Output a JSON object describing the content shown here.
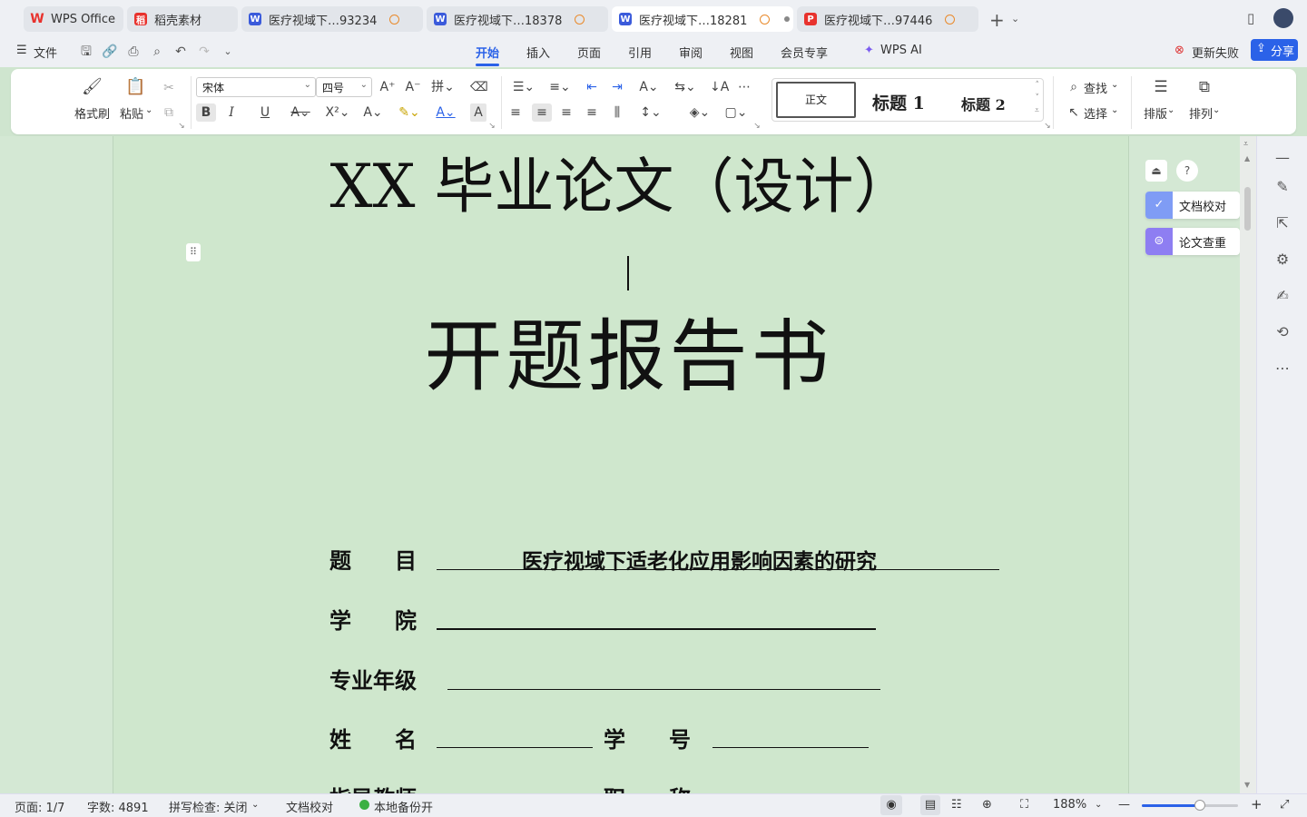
{
  "tabs": [
    {
      "label": "WPS Office",
      "icon": "wps-logo-icon",
      "color": "#e8322d"
    },
    {
      "label": "稻壳素材",
      "icon": "docer-icon",
      "color": "#e8322d"
    },
    {
      "label": "医疗视域下…93234",
      "icon": "word-doc-icon",
      "color": "#3b5bdb",
      "warning": true
    },
    {
      "label": "医疗视域下…18378",
      "icon": "word-doc-icon",
      "color": "#3b5bdb",
      "warning": true
    },
    {
      "label": "医疗视域下…18281",
      "icon": "word-doc-icon",
      "color": "#3b5bdb",
      "warning": true,
      "active": true
    },
    {
      "label": "医疗视域下…97446",
      "icon": "ppt-doc-icon",
      "color": "#e8322d",
      "warning": true
    }
  ],
  "menu": {
    "file": "文件",
    "tabs": [
      "开始",
      "插入",
      "页面",
      "引用",
      "审阅",
      "视图",
      "会员专享"
    ],
    "active": "开始",
    "wps_ai": "WPS AI",
    "update_failed": "更新失败",
    "share": "分享"
  },
  "ribbon": {
    "format_painter": "格式刷",
    "paste": "粘贴",
    "font_name": "宋体",
    "font_size": "四号",
    "style_normal": "正文",
    "style_h1": "标题 1",
    "style_h2": "标题 2",
    "find": "查找",
    "select": "选择",
    "layout": "排版",
    "arrange": "排列",
    "bold": "B",
    "italic": "I",
    "underline": "U"
  },
  "document": {
    "title": "XX 毕业论文（设计）",
    "subtitle": "开题报告书",
    "fields": {
      "topic_label": "题　　目",
      "topic_value": "医疗视域下适老化应用影响因素的研究",
      "college_label": "学　　院",
      "major_label": "专业年级",
      "name_label": "姓　　名",
      "student_id_label": "学　　号",
      "advisor_label": "指导教师",
      "title_label": "职　　称"
    }
  },
  "side_tools": {
    "proofread": "文档校对",
    "plagiarism": "论文查重"
  },
  "status": {
    "page": "页面: 1/7",
    "words": "字数: 4891",
    "spell": "拼写检查: 关闭",
    "proof": "文档校对",
    "backup": "本地备份开",
    "zoom": "188%",
    "zoom_fraction": 0.6
  },
  "colors": {
    "accent": "#2b62e8",
    "doc_bg": "#cfe7cd",
    "warning": "#e98a2b"
  }
}
